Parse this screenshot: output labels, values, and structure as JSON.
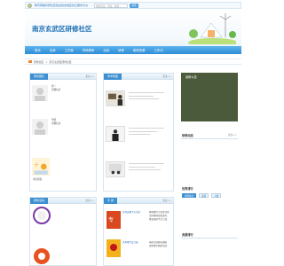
{
  "topbar": {
    "title": "教育网络科研化区建设综合地区的云服务平台",
    "search_placeholder": "搜索名班、活动、资源…",
    "search_button": "搜索"
  },
  "banner": {
    "site_title": "南京玄武区研修社区"
  },
  "nav": {
    "items": [
      "首页",
      "名师",
      "工作室",
      "学科教研",
      "活动",
      "研修",
      "研修资源",
      "工作坊"
    ]
  },
  "breadcrumb": {
    "items": [
      "研修社区",
      "南京玄武区研修社区"
    ]
  },
  "panels": {
    "expert": {
      "tab": "研修团队",
      "more": "更多>>",
      "rows": [
        {
          "name": "黄一",
          "subtitle": "详细信息"
        },
        {
          "name": "李明",
          "subtitle": "详细信息"
        },
        {
          "name": "专家团队",
          "subtitle": ""
        }
      ]
    },
    "classroom": {
      "tab": "学术联盟",
      "more": "更多>>"
    },
    "notice": {
      "tab": "最新公告"
    },
    "dynamics": {
      "head": "研修动态",
      "more": "更多>>"
    },
    "ranking": {
      "head": "优秀排行",
      "buttons": [
        "老师积分",
        "资源",
        "人数"
      ]
    },
    "resources": {
      "head": "资源排行"
    },
    "activity": {
      "tab": "研修活动",
      "more": "更多>>"
    },
    "special": {
      "tab": "专 题",
      "more": "更多>>",
      "items": [
        {
          "title": "名师送教下乡活动",
          "lines": [
            "教师教学大讲堂活动",
            "全区教师技能提升",
            "教育研修平台上线"
          ]
        },
        {
          "title": "优秀教学设计展",
          "lines": [
            "研修活动报名通知",
            "课堂教学观摩活动"
          ]
        }
      ]
    }
  },
  "colors": {
    "accent": "#3d8fd1",
    "nav": "#2f8dd6",
    "title": "#1e6fb3",
    "notice_bg": "#4a5a3a"
  }
}
